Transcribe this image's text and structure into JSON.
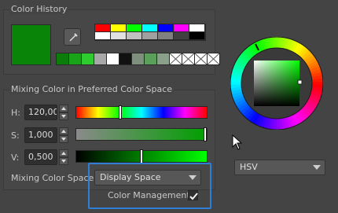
{
  "color_history": {
    "title": "Color History",
    "current_color": "#098409",
    "picker_icon": "eyedropper-icon",
    "palette_top_row": [
      "#ff0000",
      "#ffff00",
      "#00ff00",
      "#00ffff",
      "#0000ff",
      "#ff00ff",
      "#ffffff"
    ],
    "palette_bottom_row": [
      "#ffffff",
      "#e0e0e0",
      "#c0c0c0",
      "#a0a0a0",
      "#808080",
      "#404040",
      "#000000"
    ],
    "recent_colors": [
      "#0b7d0b",
      "#19a319",
      "#2ecc2e",
      "#a8a8a8",
      "#ffffff",
      "#111111",
      "#7e8f7e",
      "#5aa05a",
      "#8aa08a"
    ],
    "empty_slots": 4
  },
  "mixing": {
    "title": "Mixing Color in Preferred Color Space",
    "channels": [
      {
        "label": "H:",
        "value": "120,000",
        "level": 0.333
      },
      {
        "label": "S:",
        "value": "1,000",
        "level": 1.0
      },
      {
        "label": "V:",
        "value": "0,500",
        "level": 0.5
      }
    ],
    "space_label": "Mixing Color Space:",
    "space_value": "Display Space",
    "color_management_label": "Color Management",
    "color_management_checked": true
  },
  "wheel": {
    "model": "HSV",
    "hue_marker_icon": "hue-marker",
    "accent": "#2f7fd6"
  }
}
